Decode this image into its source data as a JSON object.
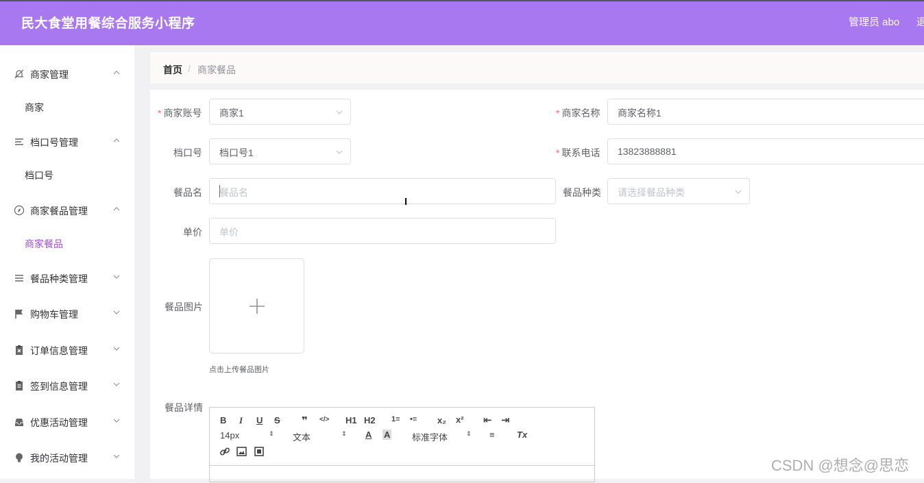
{
  "header": {
    "title": "民大食堂用餐综合服务小程序",
    "admin": "管理员 abo",
    "logout": "退"
  },
  "sidebar": {
    "groups": [
      {
        "label": "商家管理",
        "icon": "bell-off-icon",
        "expanded": true,
        "sub": "商家"
      },
      {
        "label": "档口号管理",
        "icon": "list-icon",
        "expanded": true,
        "sub": "档口号"
      },
      {
        "label": "商家餐品管理",
        "icon": "compass-icon",
        "expanded": true,
        "sub": "商家餐品"
      },
      {
        "label": "餐品种类管理",
        "icon": "list-icon",
        "expanded": false
      },
      {
        "label": "购物车管理",
        "icon": "flag-icon",
        "expanded": false
      },
      {
        "label": "订单信息管理",
        "icon": "clipboard-x-icon",
        "expanded": false
      },
      {
        "label": "签到信息管理",
        "icon": "clipboard-icon",
        "expanded": false
      },
      {
        "label": "优惠活动管理",
        "icon": "tray-icon",
        "expanded": false
      },
      {
        "label": "我的活动管理",
        "icon": "bulb-icon",
        "expanded": false
      }
    ],
    "active_sub": "商家餐品"
  },
  "breadcrumb": {
    "home": "首页",
    "separator": "/",
    "current": "商家餐品"
  },
  "form": {
    "merchant_account": {
      "label": "商家账号",
      "value": "商家1",
      "required": true
    },
    "merchant_name": {
      "label": "商家名称",
      "value": "商家名称1",
      "required": true
    },
    "stall_no": {
      "label": "档口号",
      "value": "档口号1",
      "required": false
    },
    "phone": {
      "label": "联系电话",
      "value": "13823888881",
      "required": true
    },
    "dish_name": {
      "label": "餐品名",
      "placeholder": "餐品名"
    },
    "dish_category": {
      "label": "餐品种类",
      "placeholder": "请选择餐品种类"
    },
    "price": {
      "label": "单价",
      "placeholder": "单价"
    },
    "dish_image": {
      "label": "餐品图片",
      "upload_tip": "点击上传餐品图片"
    },
    "dish_detail": {
      "label": "餐品详情"
    }
  },
  "editor_toolbar": {
    "bold": "B",
    "italic": "I",
    "underline": "U",
    "strike": "S",
    "quote": "❞",
    "code": "</>",
    "h1": "H1",
    "h2": "H2",
    "ordered_list": "1≡",
    "bullet_list": "•≡",
    "subscript": "x₂",
    "superscript": "x²",
    "outdent": "⇤",
    "indent": "⇥",
    "font_size": "14px",
    "paragraph": "文本",
    "font_family": "标准字体",
    "font_color": "A",
    "background_color": "A",
    "align": "≡",
    "clear_format": "Tx"
  },
  "watermark": "CSDN @想念@思恋"
}
